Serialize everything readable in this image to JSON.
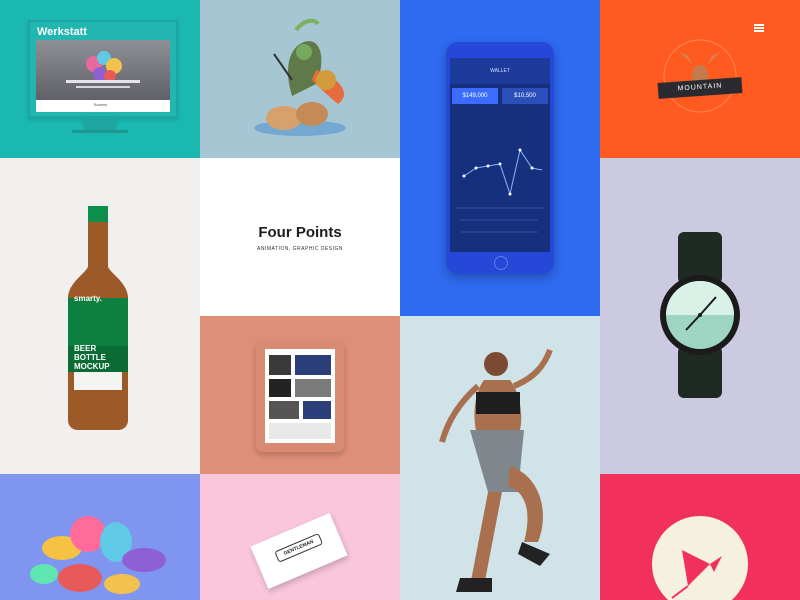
{
  "tiles": [
    {
      "id": "werkstatt",
      "bg": "#1ab8b1",
      "title": "Werkstatt",
      "footer": "Bowers"
    },
    {
      "id": "warrior-illustration",
      "bg": "#a6c6d4"
    },
    {
      "id": "wallet-app",
      "bg": "#2f6bf0",
      "header": "WALLET",
      "balance_left": "$149,000",
      "balance_right": "$10,500"
    },
    {
      "id": "mountain-badge",
      "bg": "#ff5a1f",
      "badge_text": "MOUNTAIN"
    },
    {
      "id": "beer-bottle",
      "bg": "#f1f0ee",
      "brand": "smarty.",
      "label_line1": "BEER",
      "label_line2": "BOTTLE",
      "label_line3": "MOCKUP"
    },
    {
      "id": "four-points",
      "bg": "#ffffff",
      "title": "Four Points",
      "subtitle": "ANIMATION, GRAPHIC DESIGN"
    },
    {
      "id": "watch",
      "bg": "#cbcae1"
    },
    {
      "id": "tablet",
      "bg": "#df8f77"
    },
    {
      "id": "athlete",
      "bg": "#cfe3e8"
    },
    {
      "id": "shapes",
      "bg": "#7f95ef"
    },
    {
      "id": "business-card",
      "bg": "#f9c6dc",
      "card_text": "GENTLEMAN"
    },
    {
      "id": "circle-logo",
      "bg": "#f2305c"
    }
  ]
}
